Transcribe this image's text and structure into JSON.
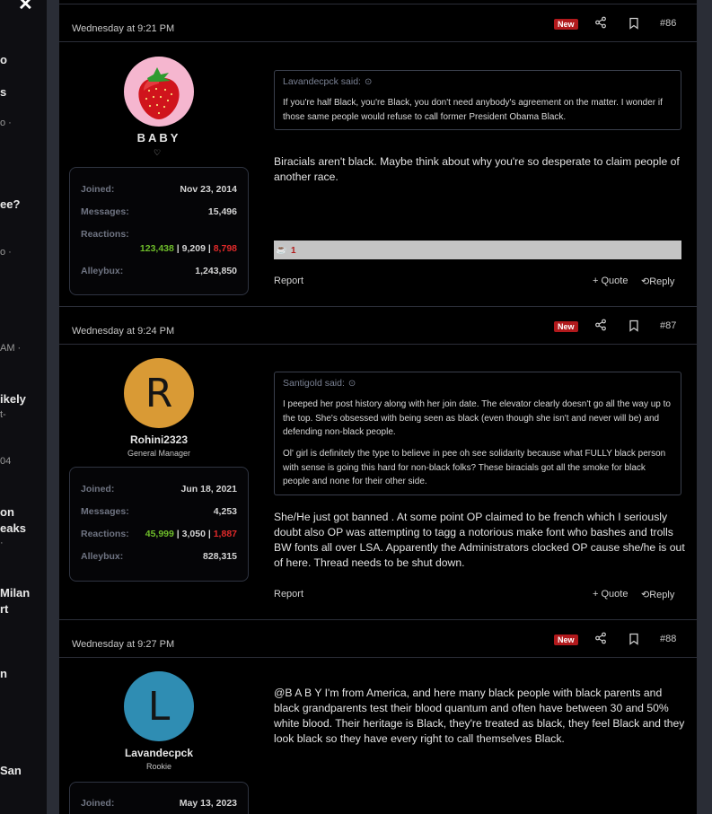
{
  "sidebar": {
    "close_glyph": "✕",
    "fragments": [
      "o",
      "s",
      "o ·",
      "ee?",
      "o ·",
      "AM ·",
      "ikely",
      "t-",
      "04",
      "on",
      "eaks",
      "·",
      "Milan",
      "rt",
      "n",
      "San"
    ]
  },
  "icons": {
    "share": "share-icon",
    "bookmark": "bookmark-icon",
    "quote_expand": "arrow-up-icon",
    "reaction": "coffee-icon",
    "heart": "heart-icon"
  },
  "colors": {
    "new_badge": "#b1191c",
    "reaction_green": "#6ebd2a",
    "reaction_red": "#e22a2a",
    "border": "#2b2e38"
  },
  "posts": [
    {
      "date": "Wednesday at 9:21 PM",
      "badge": "New",
      "number": "#86",
      "user": {
        "name": "BABY",
        "title": "",
        "heart": "♡",
        "avatar_letter": "",
        "avatar_bg": "#f5b6cf"
      },
      "stats": {
        "joined_label": "Joined:",
        "joined": "Nov 23, 2014",
        "messages_label": "Messages:",
        "messages": "15,496",
        "reactions_label": "Reactions:",
        "react_pos": "123,438",
        "react_neu": "9,209",
        "react_neg": "8,798",
        "sep": " | ",
        "alleybux_label": "Alleybux:",
        "alleybux": "1,243,850"
      },
      "quote": {
        "author": "Lavandecpck said:",
        "paragraphs": [
          "If you're half Black, you're Black, you don't need anybody's agreement on the matter. I wonder if those same people would refuse to call former President Obama Black."
        ]
      },
      "body": "Biracials aren't black. Maybe think about why you're so desperate to claim people of another race.",
      "reaction_count": "1",
      "report": "Report",
      "quote_btn": "+ Quote",
      "reply_btn": "Reply"
    },
    {
      "date": "Wednesday at 9:24 PM",
      "badge": "New",
      "number": "#87",
      "user": {
        "name": "Rohini2323",
        "title": "General Manager",
        "avatar_letter": "R",
        "avatar_bg": "#d99a35"
      },
      "stats": {
        "joined_label": "Joined:",
        "joined": "Jun 18, 2021",
        "messages_label": "Messages:",
        "messages": "4,253",
        "reactions_label": "Reactions:",
        "react_pos": "45,999",
        "react_neu": "3,050",
        "react_neg": "1,887",
        "sep": " | ",
        "alleybux_label": "Alleybux:",
        "alleybux": "828,315"
      },
      "quote": {
        "author": "Santigold said:",
        "paragraphs": [
          "I peeped her post history along with her join date. The elevator clearly doesn't go all the way up to the top. She's obsessed with being seen as black (even though she isn't and never will be) and defending non-black people.",
          "Ol' girl is definitely the type to believe in pee oh see solidarity because what FULLY black person with sense is going this hard for non-black folks? These biracials got all the smoke for black people and none for their other side."
        ]
      },
      "body": "She/He just got banned . At some point OP claimed to be french which I seriously doubt also OP was attempting to tagg a notorious make font who bashes and trolls BW fonts all over LSA. Apparently the Administrators clocked OP cause she/he is out of here. Thread needs to be shut down.",
      "report": "Report",
      "quote_btn": "+ Quote",
      "reply_btn": "Reply"
    },
    {
      "date": "Wednesday at 9:27 PM",
      "badge": "New",
      "number": "#88",
      "user": {
        "name": "Lavandecpck",
        "title": "Rookie",
        "avatar_letter": "L",
        "avatar_bg": "#2f8db3"
      },
      "stats": {
        "joined_label": "Joined:",
        "joined": "May 13, 2023"
      },
      "body": "@B A B Y I'm from America, and here many black people with black parents and black grandparents test their blood quantum and often have between 30 and 50% white blood. Their heritage is Black, they're treated as black, they feel Black and they look black so they have every right to call themselves Black."
    }
  ]
}
